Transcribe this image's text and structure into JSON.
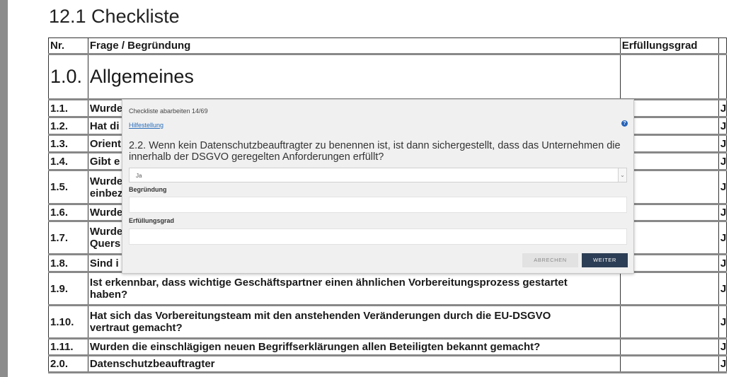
{
  "page": {
    "title": "12.1 Checkliste"
  },
  "table": {
    "headers": {
      "nr": "Nr.",
      "question": "Frage / Begründung",
      "fulfillment": "Erfüllungsgrad"
    },
    "section1": {
      "nr": "1.0.",
      "title": "Allgemeines"
    },
    "rows": [
      {
        "nr": "1.1.",
        "text": "Wurde",
        "j": "J"
      },
      {
        "nr": "1.2.",
        "text": "Hat di",
        "j": "J"
      },
      {
        "nr": "1.3.",
        "text": "Orient",
        "j": "J"
      },
      {
        "nr": "1.4.",
        "text": "Gibt e",
        "j": "J"
      },
      {
        "nr": "1.5.",
        "line1": "Wurde",
        "line2": "einbez",
        "j": "J"
      },
      {
        "nr": "1.6.",
        "text": "Wurde",
        "j": "J"
      },
      {
        "nr": "1.7.",
        "line1": "Wurde",
        "line2": "Quers",
        "j": "J"
      },
      {
        "nr": "1.8.",
        "text": "Sind i",
        "j": "J"
      },
      {
        "nr": "1.9.",
        "line1": "Ist erkennbar, dass wichtige Geschäftspartner einen ähnlichen Vorbereitungsprozess gestartet",
        "line2": "haben?",
        "j": "J"
      },
      {
        "nr": "1.10.",
        "line1": "Hat sich das Vorbereitungsteam mit den anstehenden Veränderungen durch die EU-DSGVO",
        "line2": "vertraut gemacht?",
        "j": "J"
      },
      {
        "nr": "1.11.",
        "text": "Wurden die einschlägigen neuen Begriffserklärungen allen Beteiligten bekannt gemacht?",
        "j": "J"
      },
      {
        "nr": "2.0.",
        "text": "Datenschutzbeauftragter",
        "j": "J"
      }
    ]
  },
  "modal": {
    "title": "Checkliste abarbeiten 14/69",
    "help_link": "Hilfestellung",
    "help_icon": "question-circle-icon",
    "question": "2.2. Wenn kein Datenschutzbeauftragter zu benennen ist, ist dann sichergestellt, dass das Unternehmen die innerhalb der DSGVO geregelten Anforderungen erfüllt?",
    "answer_selected": "Ja",
    "reason_label": "Begründung",
    "reason_value": "",
    "fulfillment_label": "Erfüllungsgrad",
    "fulfillment_value": "",
    "cancel_label": "ABRECHEN",
    "next_label": "WEITER"
  },
  "colors": {
    "accent_button": "#2c3e55",
    "link": "#2a6ebb",
    "help_icon": "#2563b8"
  }
}
